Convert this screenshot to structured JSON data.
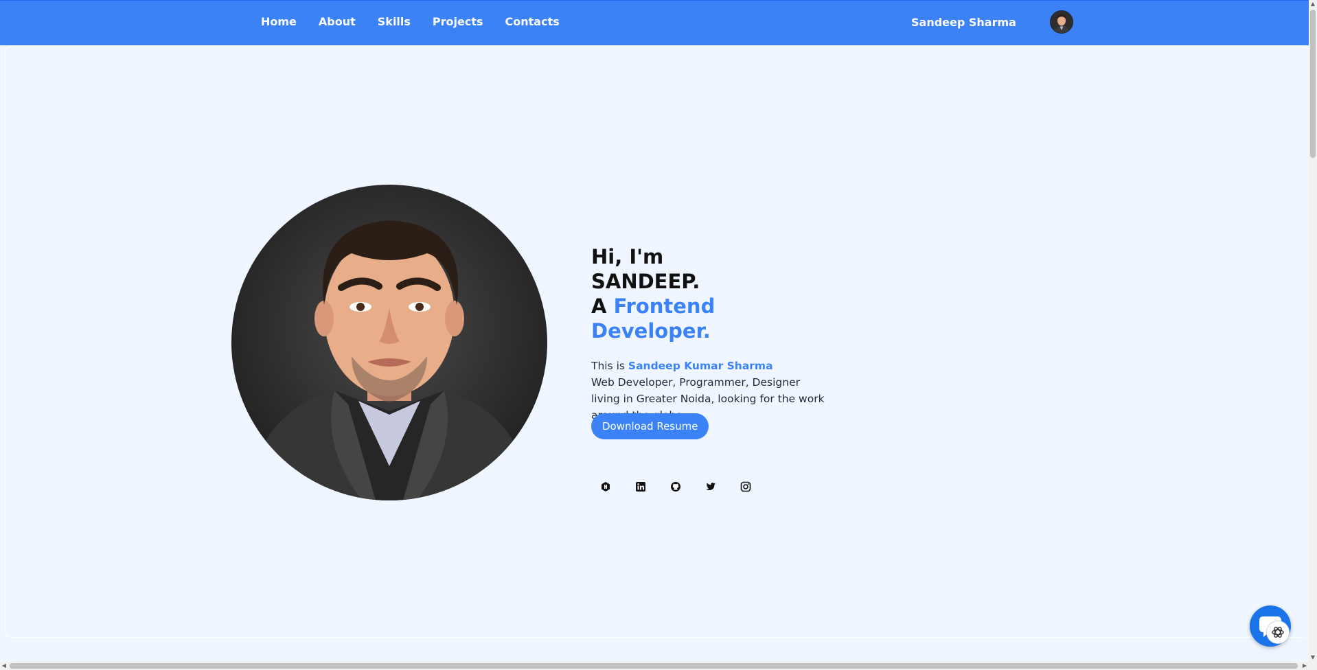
{
  "nav": {
    "items": [
      "Home",
      "About",
      "Skills",
      "Projects",
      "Contacts"
    ],
    "brand": "Sandeep Sharma"
  },
  "hero": {
    "line1": "Hi, I'm",
    "line2": "SANDEEP.",
    "line3_prefix": "A",
    "line3_accent": "Frontend Developer.",
    "intro_prefix": "This is",
    "intro_name": "Sandeep Kumar Sharma",
    "intro_rest": "Web Developer, Programmer, Designer living in Greater Noida, looking for the work around the globe.",
    "resume_button": "Download Resume"
  },
  "socials": [
    "hashnode-icon",
    "linkedin-icon",
    "github-icon",
    "twitter-icon",
    "instagram-icon"
  ],
  "chat": {
    "icon": "chat-bot-icon"
  },
  "colors": {
    "primary": "#3b82f6",
    "background": "#eff6ff"
  }
}
